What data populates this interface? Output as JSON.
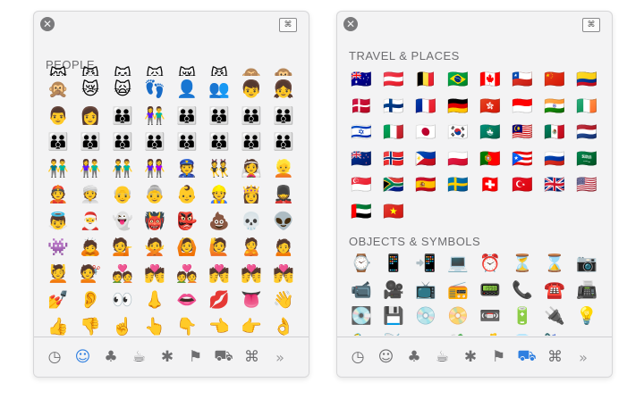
{
  "left_panel": {
    "section_title": "PEOPLE",
    "top_row_partial": [
      "😹",
      "😼",
      "😽",
      "🙀",
      "😿",
      "😾",
      "🙈",
      "🙉"
    ],
    "rows": [
      [
        "🙊",
        "😿",
        "🙀",
        "👣",
        "👤",
        "👥",
        "👦",
        "👧"
      ],
      [
        "👨",
        "👩",
        "👪",
        "👫",
        "👪",
        "👪",
        "👪",
        "👪"
      ],
      [
        "👪",
        "👪",
        "👪",
        "👪",
        "👪",
        "👪",
        "👪",
        "👪"
      ],
      [
        "👬",
        "👫",
        "👬",
        "👭",
        "👮",
        "👯",
        "👰",
        "👱"
      ],
      [
        "👲",
        "👳",
        "👴",
        "👵",
        "👶",
        "👷",
        "👸",
        "💂"
      ],
      [
        "👼",
        "🎅",
        "👻",
        "👹",
        "👺",
        "💩",
        "💀",
        "👽"
      ],
      [
        "👾",
        "🙇",
        "💁",
        "🙅",
        "🙆",
        "🙋",
        "🙎",
        "🙍"
      ],
      [
        "💆",
        "💇",
        "💑",
        "💏",
        "💑",
        "💏",
        "💏",
        "💏"
      ],
      [
        "💅",
        "👂",
        "👀",
        "👃",
        "👄",
        "💋",
        "👅",
        "👋"
      ],
      [
        "👍",
        "👎",
        "☝️",
        "👆",
        "👇",
        "👈",
        "👉",
        "👌"
      ]
    ]
  },
  "right_panel": {
    "section1_title": "TRAVEL & PLACES",
    "flags": [
      [
        "🇦🇺",
        "🇦🇹",
        "🇧🇪",
        "🇧🇷",
        "🇨🇦",
        "🇨🇱",
        "🇨🇳",
        "🇨🇴"
      ],
      [
        "🇩🇰",
        "🇫🇮",
        "🇫🇷",
        "🇩🇪",
        "🇭🇰",
        "🇮🇩",
        "🇮🇳",
        "🇮🇪"
      ],
      [
        "🇮🇱",
        "🇮🇹",
        "🇯🇵",
        "🇰🇷",
        "🇲🇴",
        "🇲🇾",
        "🇲🇽",
        "🇳🇱"
      ],
      [
        "🇳🇿",
        "🇳🇴",
        "🇵🇭",
        "🇵🇱",
        "🇵🇹",
        "🇵🇷",
        "🇷🇺",
        "🇸🇦"
      ],
      [
        "🇸🇬",
        "🇿🇦",
        "🇪🇸",
        "🇸🇪",
        "🇨🇭",
        "🇹🇷",
        "🇬🇧",
        "🇺🇸"
      ],
      [
        "🇦🇪",
        "🇻🇳"
      ]
    ],
    "section2_title": "OBJECTS & SYMBOLS",
    "objects": [
      [
        "⌚",
        "📱",
        "📲",
        "💻",
        "⏰",
        "⏳",
        "⌛",
        "📷"
      ],
      [
        "📹",
        "🎥",
        "📺",
        "📻",
        "📟",
        "📞",
        "☎️",
        "📠"
      ],
      [
        "💽",
        "💾",
        "💿",
        "📀",
        "📼",
        "🔋",
        "🔌",
        "💡"
      ],
      [
        "🔦",
        "📡",
        "💳",
        "💸",
        "💰",
        "💎",
        "🌂",
        "👝"
      ]
    ]
  },
  "tabs": [
    {
      "name": "recent",
      "glyph": "◷"
    },
    {
      "name": "people",
      "glyph": "☺"
    },
    {
      "name": "nature",
      "glyph": "♣"
    },
    {
      "name": "food",
      "glyph": "☕"
    },
    {
      "name": "celebration",
      "glyph": "✱"
    },
    {
      "name": "activity",
      "glyph": "⚑"
    },
    {
      "name": "travel",
      "glyph": "⛟"
    },
    {
      "name": "symbols",
      "glyph": "⌘"
    },
    {
      "name": "more",
      "glyph": "»"
    }
  ],
  "left_selected_tab": "people",
  "right_selected_tab": "travel",
  "viewer_icon_glyph": "⌘",
  "close_glyph": "✕",
  "colors": {
    "accent": "#2f7fe0",
    "panel_bg": "#f3f3f4",
    "title_gray": "#6d6d70"
  }
}
